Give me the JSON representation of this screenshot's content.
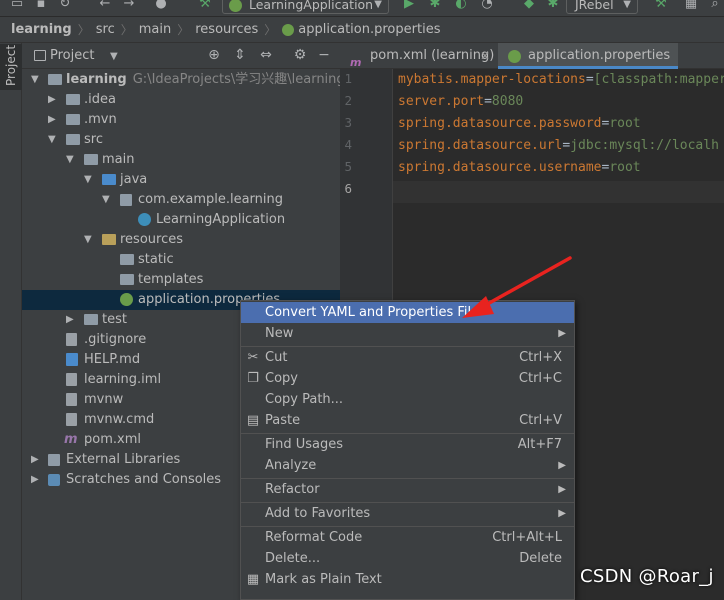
{
  "toolbar": {
    "run_config": "LearningApplication",
    "jrebel": "JRebel"
  },
  "breadcrumb": [
    "learning",
    "src",
    "main",
    "resources",
    "application.properties"
  ],
  "stripe_label": "Project",
  "project_panel": {
    "title": "Project"
  },
  "tree": [
    {
      "label": "learning",
      "path": "G:\\IdeaProjects\\学习兴趣\\learning"
    },
    {
      "label": ".idea"
    },
    {
      "label": ".mvn"
    },
    {
      "label": "src"
    },
    {
      "label": "main"
    },
    {
      "label": "java"
    },
    {
      "label": "com.example.learning"
    },
    {
      "label": "LearningApplication"
    },
    {
      "label": "resources"
    },
    {
      "label": "static"
    },
    {
      "label": "templates"
    },
    {
      "label": "application.properties"
    },
    {
      "label": "test"
    },
    {
      "label": ".gitignore"
    },
    {
      "label": "HELP.md"
    },
    {
      "label": "learning.iml"
    },
    {
      "label": "mvnw"
    },
    {
      "label": "mvnw.cmd"
    },
    {
      "label": "pom.xml"
    },
    {
      "label": "External Libraries"
    },
    {
      "label": "Scratches and Consoles"
    }
  ],
  "tabs": [
    {
      "label": "pom.xml (learning)"
    },
    {
      "label": "application.properties"
    }
  ],
  "code": [
    {
      "key": "mybatis.mapper-locations",
      "value": "[classpath:mapper"
    },
    {
      "key": "server.port",
      "value": "8080"
    },
    {
      "key": "spring.datasource.password",
      "value": "root"
    },
    {
      "key": "spring.datasource.url",
      "value": "jdbc:mysql://localh"
    },
    {
      "key": "spring.datasource.username",
      "value": "root"
    },
    {
      "key": "",
      "value": ""
    }
  ],
  "line_numbers": [
    "1",
    "2",
    "3",
    "4",
    "5",
    "6"
  ],
  "menu": {
    "convert": "Convert YAML and Properties File",
    "new": "New",
    "cut": "Cut",
    "cut_sc": "Ctrl+X",
    "copy": "Copy",
    "copy_sc": "Ctrl+C",
    "copy_path": "Copy Path...",
    "paste": "Paste",
    "paste_sc": "Ctrl+V",
    "find_usages": "Find Usages",
    "find_usages_sc": "Alt+F7",
    "analyze": "Analyze",
    "refactor": "Refactor",
    "add_to_favorites": "Add to Favorites",
    "reformat_code": "Reformat Code",
    "reformat_sc": "Ctrl+Alt+L",
    "delete": "Delete...",
    "delete_sc": "Delete",
    "mark_plain": "Mark as Plain Text"
  },
  "watermark": "CSDN @Roar_j",
  "colors": {
    "highlight": "#4b6eaf",
    "annotation_arrow": "#e8231f",
    "key": "#cc7832",
    "value": "#6a8759"
  }
}
